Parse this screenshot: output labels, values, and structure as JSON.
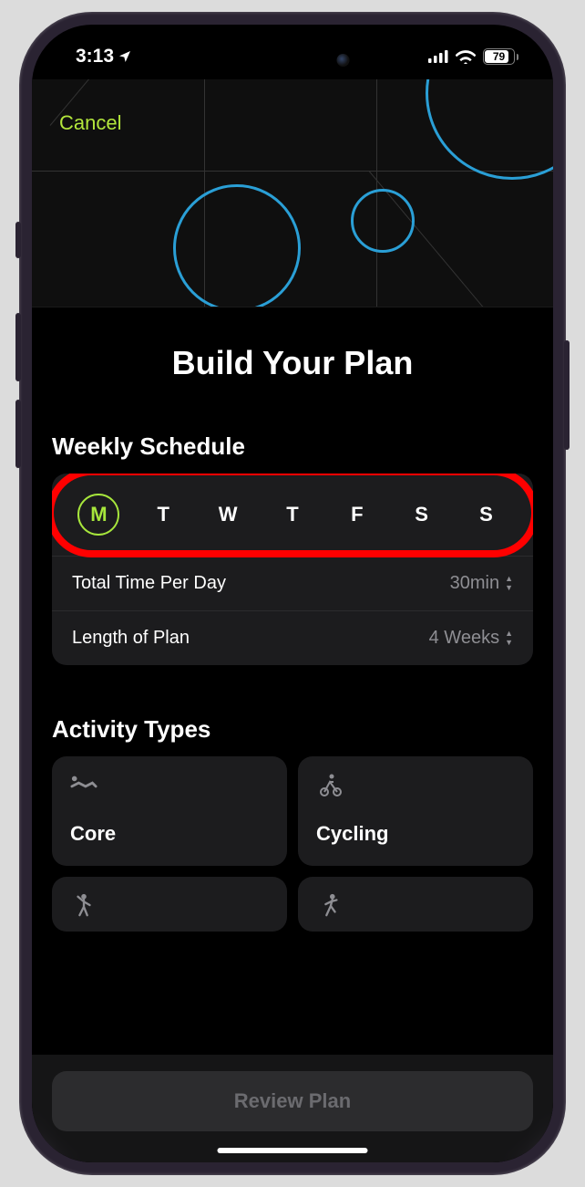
{
  "status": {
    "time": "3:13",
    "battery": "79"
  },
  "nav": {
    "cancel": "Cancel"
  },
  "title": "Build Your Plan",
  "weekly": {
    "heading": "Weekly Schedule",
    "days": [
      "M",
      "T",
      "W",
      "T",
      "F",
      "S",
      "S"
    ],
    "selected_index": 0,
    "time_label": "Total Time Per Day",
    "time_value": "30min",
    "length_label": "Length of Plan",
    "length_value": "4 Weeks"
  },
  "activities": {
    "heading": "Activity Types",
    "items": [
      {
        "label": "Core",
        "icon": "core-icon"
      },
      {
        "label": "Cycling",
        "icon": "cycling-icon"
      },
      {
        "label": "",
        "icon": "dance-icon"
      },
      {
        "label": "",
        "icon": "running-icon"
      }
    ]
  },
  "footer": {
    "review": "Review Plan"
  }
}
